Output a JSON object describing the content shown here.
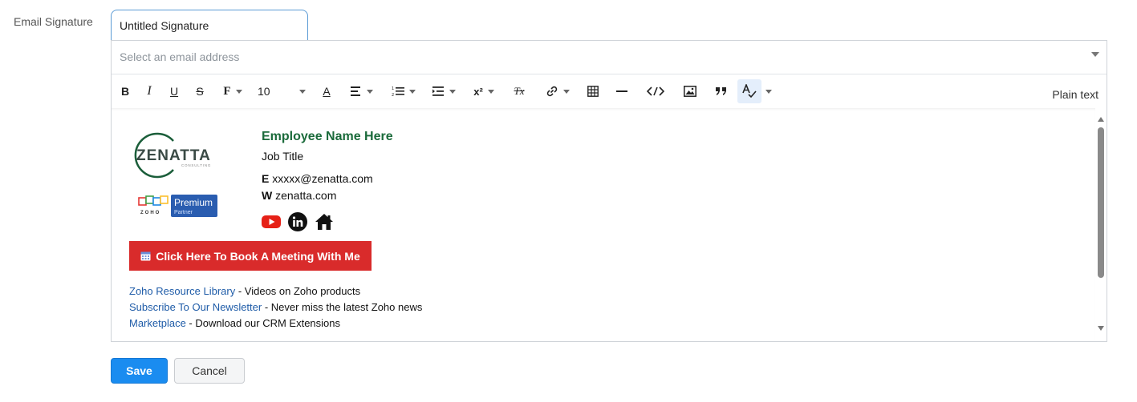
{
  "form": {
    "label": "Email Signature",
    "name_value": "Untitled Signature",
    "email_placeholder": "Select an email address"
  },
  "toolbar": {
    "bold": "B",
    "italic": "I",
    "underline": "U",
    "strike": "S",
    "font": "F",
    "font_size": "10",
    "font_color": "A",
    "superscript": "x²",
    "clear_format": "Tx",
    "plain_text": "Plain text",
    "icons": [
      "bold-icon",
      "italic-icon",
      "underline-icon",
      "strikethrough-icon",
      "font-family-icon",
      "font-size-select",
      "font-color-icon",
      "align-icon",
      "ordered-list-icon",
      "indent-icon",
      "superscript-icon",
      "clear-format-icon",
      "link-icon",
      "table-icon",
      "horizontal-line-icon",
      "code-icon",
      "image-icon",
      "quote-icon",
      "spell-check-icon"
    ]
  },
  "signature": {
    "logo_text": "ZENATTA",
    "logo_sub": "CONSULTING",
    "badge_brand": "ZOHO",
    "badge_title": "Premium",
    "badge_sub": "Partner",
    "employee_name": "Employee Name Here",
    "job_title": "Job Title",
    "email_prefix": "E",
    "email": "xxxxx@zenatta.com",
    "web_prefix": "W",
    "website": "zenatta.com",
    "social_icons": [
      "youtube-icon",
      "linkedin-icon",
      "home-icon"
    ],
    "book_button": "Click Here To Book A Meeting With Me",
    "links": [
      {
        "link": "Zoho Resource Library",
        "text": " - Videos on Zoho products"
      },
      {
        "link": "Subscribe To Our Newsletter",
        "text": " - Never miss the latest Zoho news"
      },
      {
        "link": "Marketplace",
        "text": " - Download our CRM Extensions"
      }
    ],
    "colors": {
      "name": "#1b6b3b",
      "button": "#d92b2b",
      "link": "#1f5ca8"
    }
  },
  "actions": {
    "save": "Save",
    "cancel": "Cancel"
  }
}
